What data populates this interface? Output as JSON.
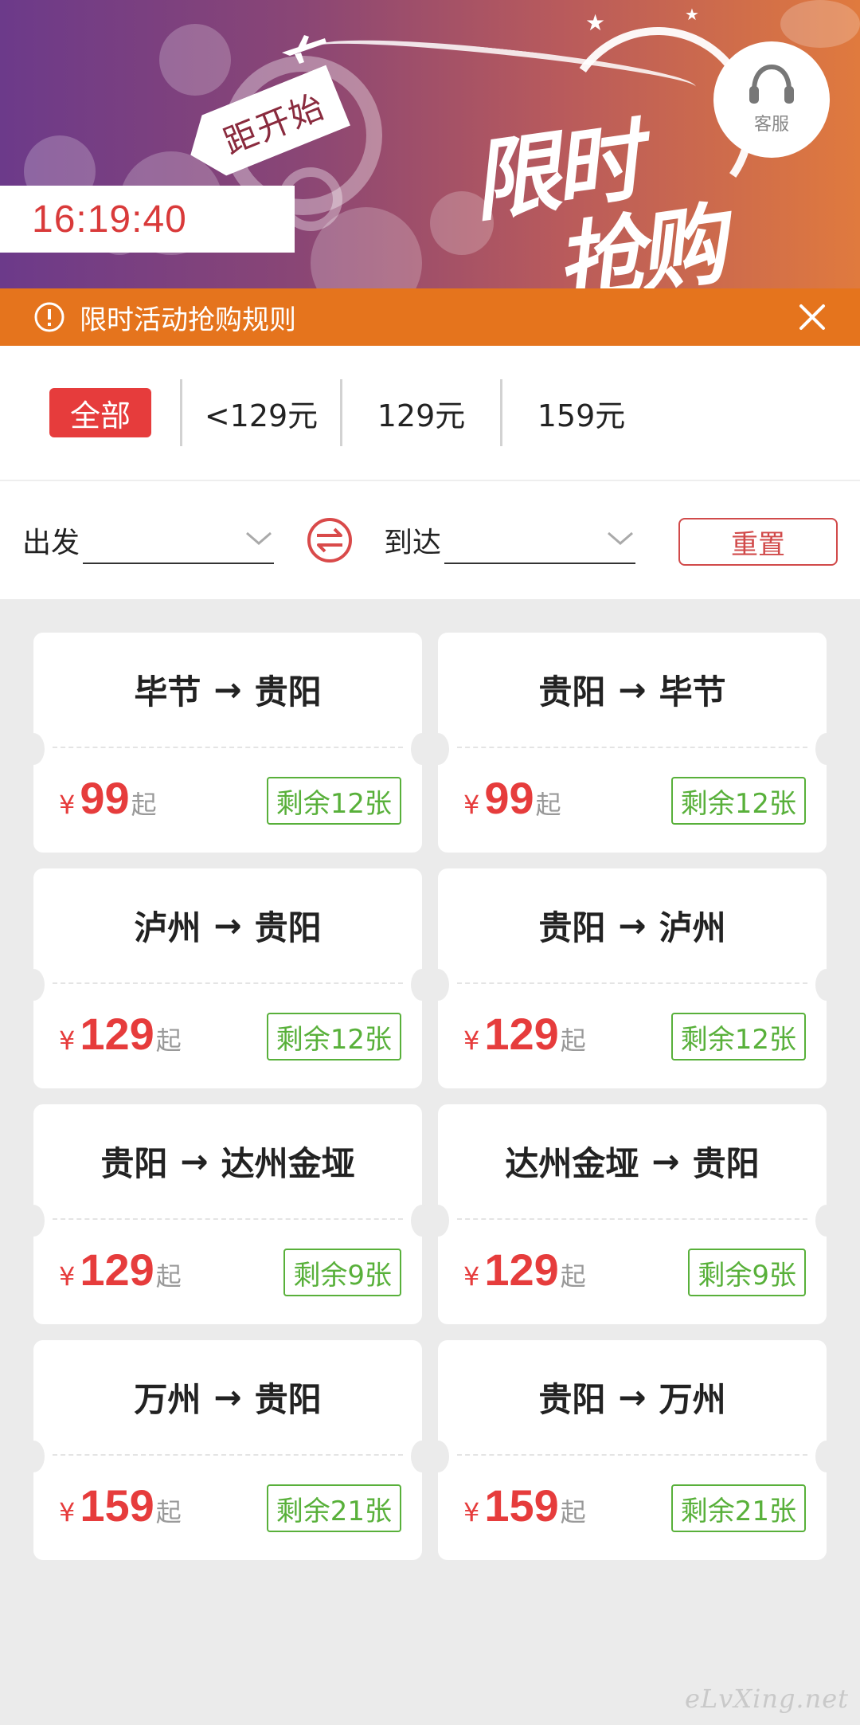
{
  "banner": {
    "sign_text": "距开始",
    "countdown": "16:19:40",
    "title_line1": "限时",
    "title_line2": "抢购",
    "service_label": "客服"
  },
  "rules_bar": {
    "text": "限时活动抢购规则"
  },
  "price_tabs": [
    {
      "label": "全部",
      "active": true
    },
    {
      "label": "<129元",
      "active": false
    },
    {
      "label": "129元",
      "active": false
    },
    {
      "label": "159元",
      "active": false
    }
  ],
  "filter": {
    "depart_label": "出发",
    "arrive_label": "到达",
    "reset_label": "重置"
  },
  "routes": [
    {
      "from": "毕节",
      "to": "贵阳",
      "currency": "¥",
      "price": "99",
      "suffix": "起",
      "stock": "剩余12张"
    },
    {
      "from": "贵阳",
      "to": "毕节",
      "currency": "¥",
      "price": "99",
      "suffix": "起",
      "stock": "剩余12张"
    },
    {
      "from": "泸州",
      "to": "贵阳",
      "currency": "¥",
      "price": "129",
      "suffix": "起",
      "stock": "剩余12张"
    },
    {
      "from": "贵阳",
      "to": "泸州",
      "currency": "¥",
      "price": "129",
      "suffix": "起",
      "stock": "剩余12张"
    },
    {
      "from": "贵阳",
      "to": "达州金垭",
      "currency": "¥",
      "price": "129",
      "suffix": "起",
      "stock": "剩余9张"
    },
    {
      "from": "达州金垭",
      "to": "贵阳",
      "currency": "¥",
      "price": "129",
      "suffix": "起",
      "stock": "剩余9张"
    },
    {
      "from": "万州",
      "to": "贵阳",
      "currency": "¥",
      "price": "159",
      "suffix": "起",
      "stock": "剩余21张"
    },
    {
      "from": "贵阳",
      "to": "万州",
      "currency": "¥",
      "price": "159",
      "suffix": "起",
      "stock": "剩余21张"
    }
  ],
  "watermark": "eLvXing.net",
  "colors": {
    "accent_red": "#e63c3c",
    "rules_orange": "#e5741d",
    "stock_green": "#58b03a"
  }
}
